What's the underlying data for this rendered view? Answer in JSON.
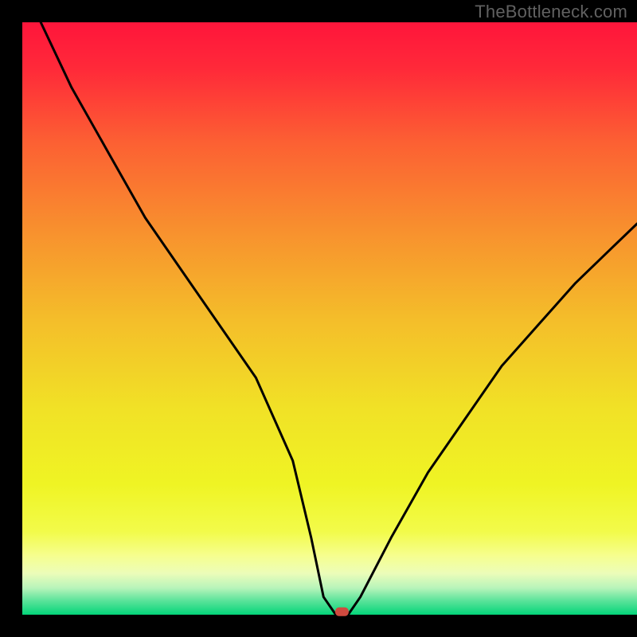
{
  "watermark": "TheBottleneck.com",
  "chart_data": {
    "type": "line",
    "title": "",
    "xlabel": "",
    "ylabel": "",
    "xlim": [
      0,
      100
    ],
    "ylim": [
      0,
      100
    ],
    "x": [
      3,
      8,
      14,
      20,
      26,
      32,
      38,
      44,
      47,
      49,
      51,
      53,
      55,
      60,
      66,
      72,
      78,
      84,
      90,
      96,
      100
    ],
    "values": [
      100,
      89,
      78,
      67,
      58,
      49,
      40,
      26,
      13,
      3,
      0,
      0,
      3,
      13,
      24,
      33,
      42,
      49,
      56,
      62,
      66
    ],
    "marker": {
      "x": 52,
      "y": 0.5,
      "color": "#cf4a3f"
    },
    "gradient_stops": [
      {
        "offset": 0.0,
        "color": "#ff153b"
      },
      {
        "offset": 0.08,
        "color": "#ff2a39"
      },
      {
        "offset": 0.2,
        "color": "#fc5f33"
      },
      {
        "offset": 0.35,
        "color": "#f8902e"
      },
      {
        "offset": 0.5,
        "color": "#f4bd2a"
      },
      {
        "offset": 0.65,
        "color": "#f1e126"
      },
      {
        "offset": 0.78,
        "color": "#eff424"
      },
      {
        "offset": 0.86,
        "color": "#f2fb4a"
      },
      {
        "offset": 0.9,
        "color": "#f6fe8e"
      },
      {
        "offset": 0.93,
        "color": "#ecfdb9"
      },
      {
        "offset": 0.955,
        "color": "#b7f4ba"
      },
      {
        "offset": 0.975,
        "color": "#60e49c"
      },
      {
        "offset": 1.0,
        "color": "#04d579"
      }
    ],
    "background_color": "#000000",
    "curve_color": "#000000"
  }
}
